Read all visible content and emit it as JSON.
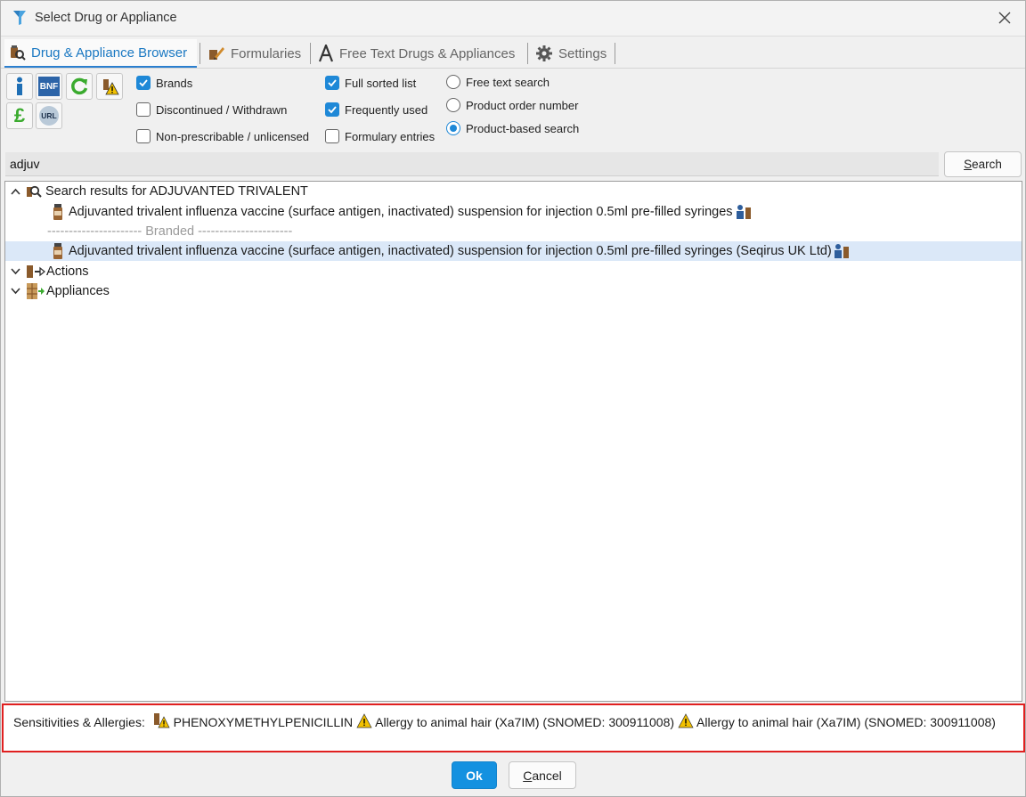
{
  "window": {
    "title": "Select Drug or Appliance"
  },
  "tabs": [
    {
      "label": "Drug & Appliance Browser",
      "icon": "drug-browser-icon",
      "active": true
    },
    {
      "label": "Formularies",
      "icon": "formulary-pen-icon"
    },
    {
      "label": "Free Text Drugs & Appliances",
      "icon": "letter-a-icon"
    },
    {
      "label": "Settings",
      "icon": "gear-icon"
    }
  ],
  "toolbar": {
    "info_icon": "info-icon",
    "bnf_label": "BNF",
    "refresh_icon": "refresh-icon",
    "warning_icon": "warning-icon",
    "price_label": "£",
    "url_label": "URL"
  },
  "checkboxes": [
    {
      "label": "Brands",
      "checked": true
    },
    {
      "label": "Discontinued / Withdrawn",
      "checked": false
    },
    {
      "label": "Non-prescribable / unlicensed",
      "checked": false
    },
    {
      "label": "Full sorted list",
      "checked": true
    },
    {
      "label": "Frequently used",
      "checked": true
    },
    {
      "label": "Formulary entries",
      "checked": false
    }
  ],
  "radios": [
    {
      "label": "Free text search",
      "checked": false
    },
    {
      "label": "Product order number",
      "checked": false
    },
    {
      "label": "Product-based search",
      "checked": true
    }
  ],
  "search": {
    "value": "adjuv",
    "button_label": "Search",
    "button_mnemonic": "S",
    "button_rest": "earch"
  },
  "tree": {
    "results_header": "Search results for ADJUVANTED TRIVALENT",
    "items": [
      {
        "label": "Adjuvanted trivalent influenza vaccine (surface antigen, inactivated) suspension for injection 0.5ml pre-filled syringes"
      },
      {
        "label": "---------------------- Branded ----------------------"
      },
      {
        "label": "Adjuvanted trivalent influenza vaccine (surface antigen, inactivated) suspension for injection 0.5ml pre-filled syringes (Seqirus UK Ltd)"
      }
    ],
    "actions_label": "Actions",
    "appliances_label": "Appliances"
  },
  "allergies": {
    "label": "Sensitivities & Allergies:",
    "entries": [
      "PHENOXYMETHYLPENICILLIN",
      "Allergy to animal hair (Xa7IM) (SNOMED: 300911008)",
      "Allergy to animal hair (Xa7IM) (SNOMED: 300911008)"
    ]
  },
  "buttons": {
    "ok": "Ok",
    "cancel_mnemonic": "C",
    "cancel_rest": "ancel"
  },
  "colors": {
    "accent": "#1491e0",
    "selected_row": "#dbe8f8",
    "allergy_border": "#e02020",
    "active_tab": "#1a78c2"
  }
}
